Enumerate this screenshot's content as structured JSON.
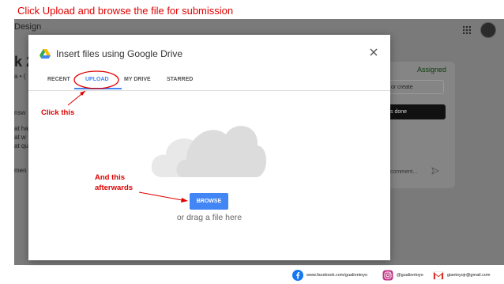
{
  "instruction": "Click Upload and browse the file for submission",
  "app": {
    "title": "Design",
    "left_fragments": [
      "k 2",
      "a • (",
      "nsw",
      "at ha",
      "at w",
      "at qu",
      "men"
    ],
    "right_panel": {
      "assigned": "Assigned",
      "create_label": "or create",
      "done_label": "s done",
      "comment_placeholder": "e comment..."
    }
  },
  "dialog": {
    "title": "Insert files using Google Drive",
    "tabs": [
      {
        "label": "RECENT",
        "active": false
      },
      {
        "label": "UPLOAD",
        "active": true
      },
      {
        "label": "MY DRIVE",
        "active": false
      },
      {
        "label": "STARRED",
        "active": false
      }
    ],
    "browse_label": "BROWSE",
    "drag_text": "or drag a file here"
  },
  "annotations": {
    "click_this": "Click this",
    "and_this": "And this",
    "afterwards": "afterwards"
  },
  "footer": {
    "facebook": "www.facebook.com/gualiontoyo",
    "instagram": "@gualiontoyo",
    "email": "giantoyojr@gmail.com"
  },
  "colors": {
    "annotation_red": "#e00000",
    "accent_blue": "#4285f4",
    "overlay_gray": "#7a7a7a"
  }
}
